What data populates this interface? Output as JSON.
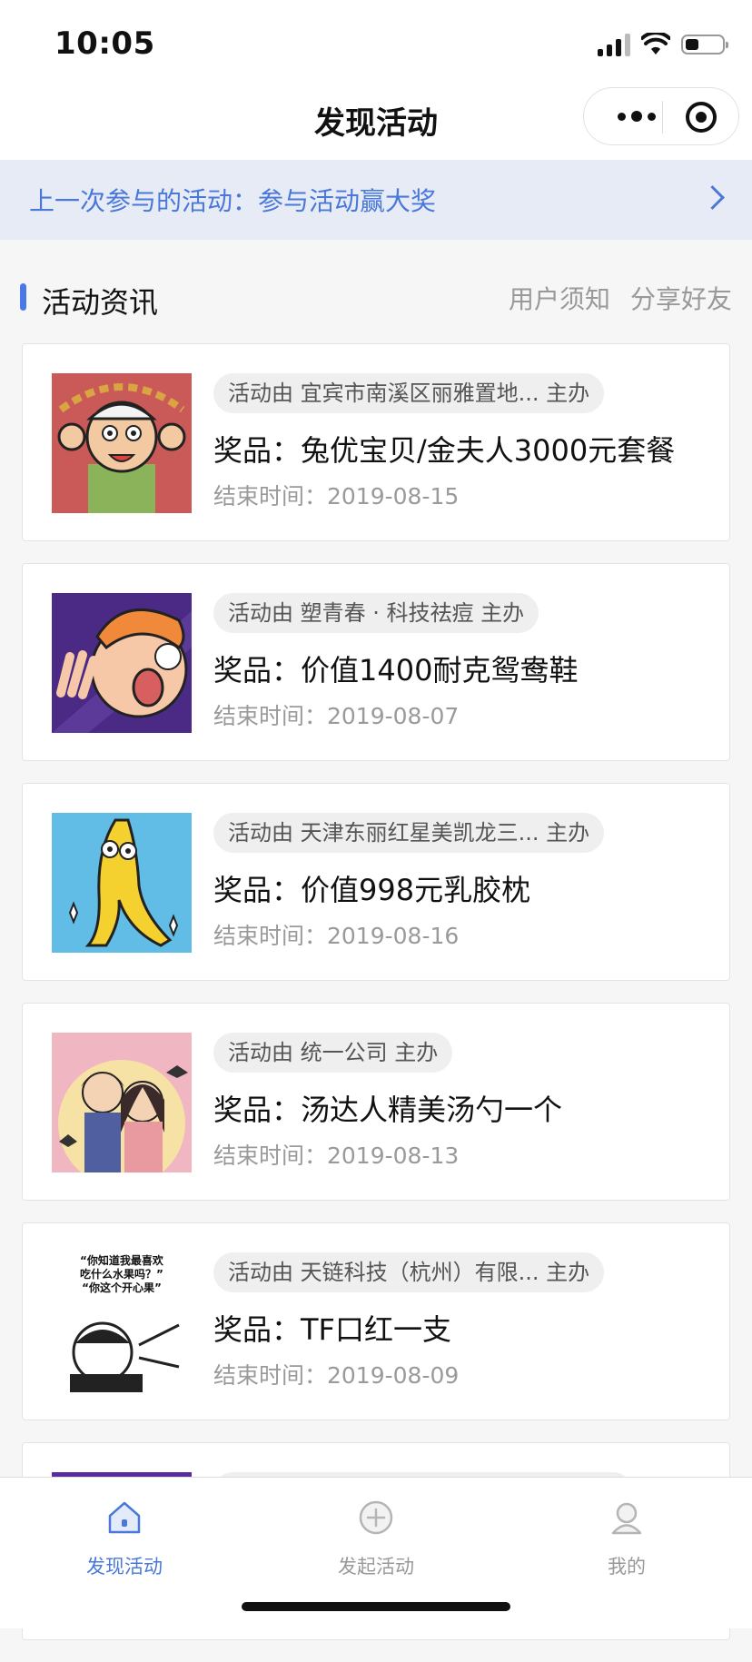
{
  "status_bar": {
    "time": "10:05"
  },
  "navbar": {
    "title": "发现活动"
  },
  "banner": {
    "text": "上一次参与的活动：参与活动赢大奖"
  },
  "section": {
    "title": "活动资讯",
    "links": [
      "用户须知",
      "分享好友"
    ]
  },
  "activities": [
    {
      "host": "活动由 宜宾市南溪区丽雅置地... 主办",
      "prize": "奖品：兔优宝贝/金夫人3000元套餐",
      "end": "结束时间：2019-08-15",
      "thumb_bg": "#c95a58"
    },
    {
      "host": "活动由 塑青春 · 科技祛痘 主办",
      "prize": "奖品：价值1400耐克鸳鸯鞋",
      "end": "结束时间：2019-08-07",
      "thumb_bg": "#4a2a84"
    },
    {
      "host": "活动由 天津东丽红星美凯龙三... 主办",
      "prize": "奖品：价值998元乳胶枕",
      "end": "结束时间：2019-08-16",
      "thumb_bg": "#62bde6"
    },
    {
      "host": "活动由 统一公司 主办",
      "prize": "奖品：汤达人精美汤勺一个",
      "end": "结束时间：2019-08-13",
      "thumb_bg": "#f0c9a8"
    },
    {
      "host": "活动由 天链科技（杭州）有限... 主办",
      "prize": "奖品：TF口红一支",
      "end": "结束时间：2019-08-09",
      "thumb_bg": "#ffffff"
    }
  ],
  "thumb5_caption": [
    "“你知道我最喜欢",
    "吃什么水果吗？”",
    "“你这个开心果”"
  ],
  "tabbar": {
    "items": [
      {
        "label": "发现活动",
        "icon": "home-icon",
        "active": true
      },
      {
        "label": "发起活动",
        "icon": "plus-circle-icon",
        "active": false
      },
      {
        "label": "我的",
        "icon": "user-icon",
        "active": false
      }
    ]
  },
  "colors": {
    "accent": "#4a78d8",
    "banner_bg": "#e6ebf6",
    "page_bg": "#f6f6f7"
  }
}
